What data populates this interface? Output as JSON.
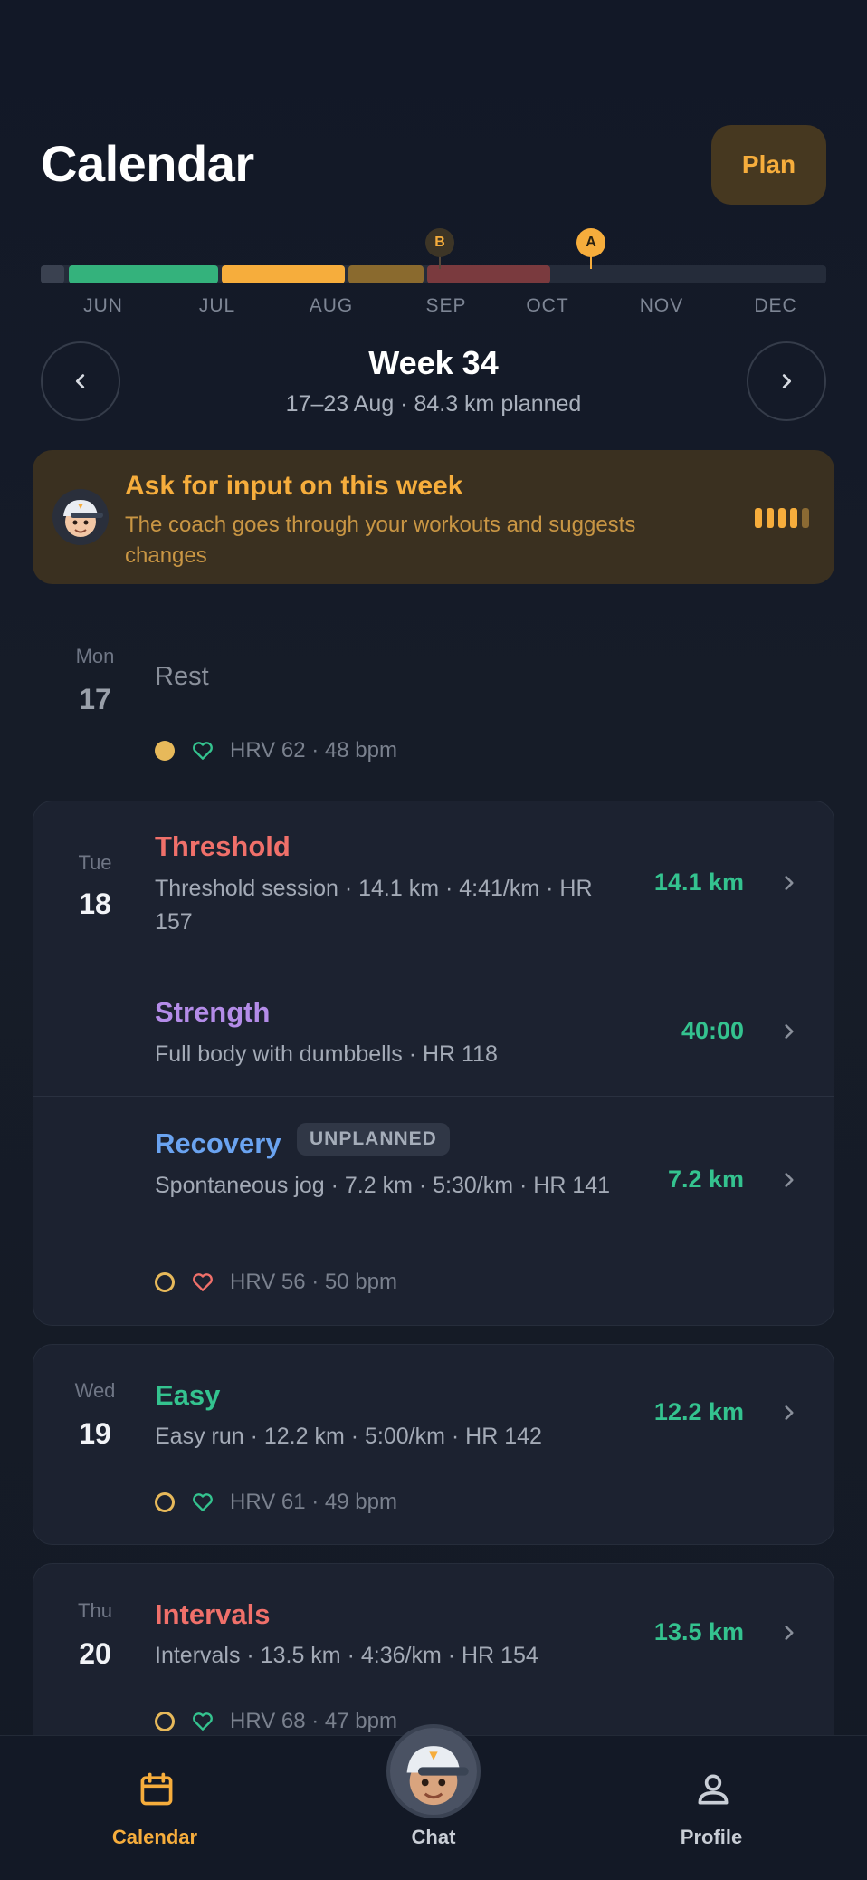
{
  "header": {
    "title": "Calendar",
    "plan_label": "Plan"
  },
  "timeline": {
    "months": [
      "JUN",
      "JUL",
      "AUG",
      "SEP",
      "OCT",
      "NOV",
      "DEC"
    ],
    "markers": [
      "B",
      "A"
    ],
    "colors": {
      "green": "#34b27c",
      "orange": "#f6ad3c",
      "brown": "#8a6a2e",
      "red": "#7a3a3e",
      "track": "#252c3a"
    }
  },
  "week": {
    "title": "Week 34",
    "subtitle": "17–23 Aug · 84.3 km planned"
  },
  "coach": {
    "title": "Ask for input on this week",
    "body": "The coach goes through your workouts and suggests changes"
  },
  "days": {
    "mon": {
      "name": "Mon",
      "num": "17",
      "rest_label": "Rest",
      "hrv": "HRV 62 · 48 bpm"
    },
    "tue": {
      "name": "Tue",
      "num": "18",
      "workouts": [
        {
          "title": "Threshold",
          "desc": "Threshold session · 14.1 km · 4:41/km · HR 157",
          "metric": "14.1 km",
          "color": "#f0706a"
        },
        {
          "title": "Strength",
          "desc": "Full body with dumbbells · HR 118",
          "metric": "40:00",
          "color": "#b48ce8"
        },
        {
          "title": "Recovery",
          "badge": "UNPLANNED",
          "desc": "Spontaneous jog · 7.2 km · 5:30/km · HR 141",
          "metric": "7.2 km",
          "color": "#6aa3f0"
        }
      ],
      "hrv": "HRV 56 · 50 bpm"
    },
    "wed": {
      "name": "Wed",
      "num": "19",
      "title": "Easy",
      "desc": "Easy run · 12.2 km · 5:00/km · HR 142",
      "metric": "12.2 km",
      "hrv": "HRV 61 · 49 bpm",
      "color": "#34c38f"
    },
    "thu": {
      "name": "Thu",
      "num": "20",
      "title": "Intervals",
      "desc": "Intervals · 13.5 km · 4:36/km · HR 154",
      "metric": "13.5 km",
      "hrv": "HRV 68 · 47 bpm",
      "color": "#f0706a"
    }
  },
  "nav": {
    "calendar": "Calendar",
    "chat": "Chat",
    "profile": "Profile",
    "active": "#f6ad3c",
    "inactive": "#c9ced6"
  }
}
